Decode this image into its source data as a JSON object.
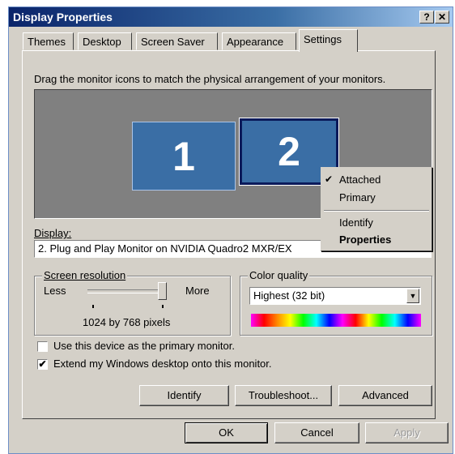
{
  "window": {
    "title": "Display Properties",
    "help_label": "?",
    "close_label": "✕"
  },
  "tabs": [
    "Themes",
    "Desktop",
    "Screen Saver",
    "Appearance",
    "Settings"
  ],
  "instructions": "Drag the monitor icons to match the physical arrangement of your monitors.",
  "monitors": [
    "1",
    "2"
  ],
  "context_menu": {
    "check": "✔",
    "items": [
      "Attached",
      "Primary",
      "Identify",
      "Properties"
    ]
  },
  "display": {
    "label": "Display:",
    "value": "2. Plug and Play Monitor on NVIDIA Quadro2 MXR/EX"
  },
  "resolution": {
    "legend": "Screen resolution",
    "less": "Less",
    "more": "More",
    "value": "1024 by 768 pixels"
  },
  "color_quality": {
    "legend": "Color quality",
    "value": "Highest (32 bit)",
    "arrow": "▼"
  },
  "checkboxes": [
    {
      "label": "Use this device as the primary monitor.",
      "checked": false,
      "mark": ""
    },
    {
      "label": "Extend my Windows desktop onto this monitor.",
      "checked": true,
      "mark": "✔"
    }
  ],
  "panel_buttons": [
    "Identify",
    "Troubleshoot...",
    "Advanced"
  ],
  "dialog_buttons": [
    "OK",
    "Cancel",
    "Apply"
  ]
}
